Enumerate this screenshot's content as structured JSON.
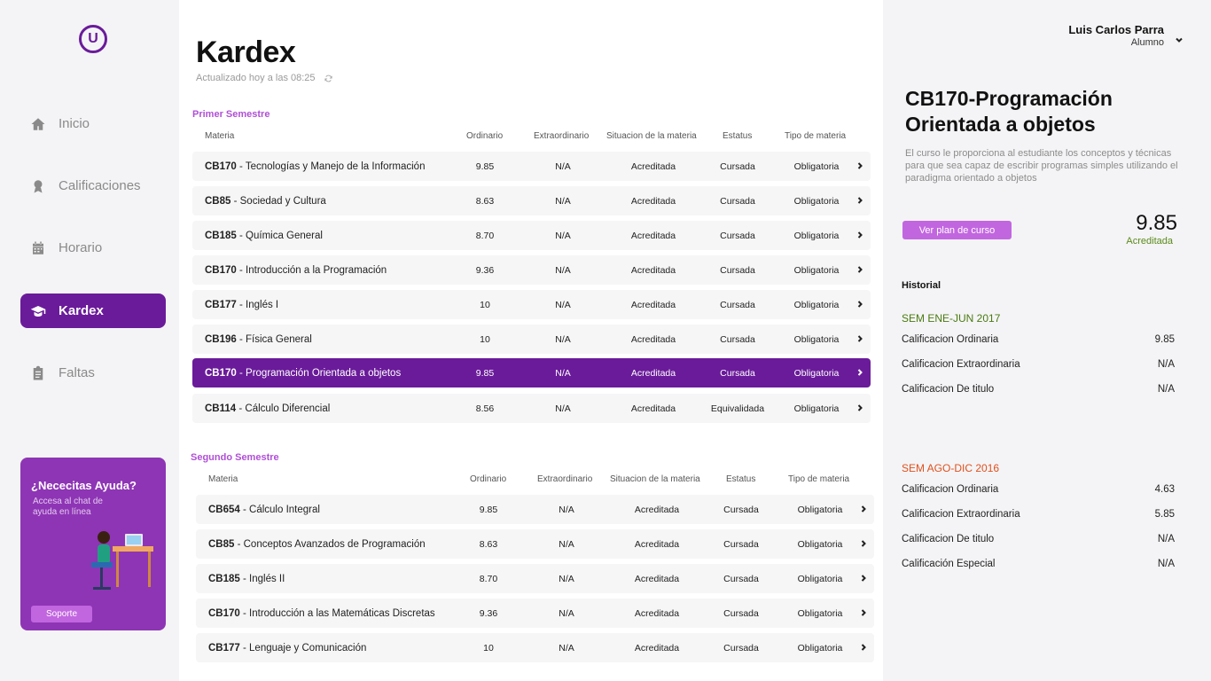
{
  "sidebar": {
    "logo_text": "U",
    "items": [
      {
        "label": "Inicio",
        "icon": "home-icon"
      },
      {
        "label": "Calificaciones",
        "icon": "award-icon"
      },
      {
        "label": "Horario",
        "icon": "calendar-icon"
      },
      {
        "label": "Kardex",
        "icon": "graduation-cap-icon"
      },
      {
        "label": "Faltas",
        "icon": "clipboard-icon"
      }
    ],
    "help": {
      "title": "¿Nececitas Ayuda?",
      "subtitle": "Accesa al chat de ayuda en línea",
      "button": "Soporte"
    }
  },
  "main": {
    "title": "Kardex",
    "updated": "Actualizado hoy a las 08:25",
    "columns": {
      "materia": "Materia",
      "ordinario": "Ordinario",
      "extraordinario": "Extraordinario",
      "situacion": "Situacion de la materia",
      "estatus": "Estatus",
      "tipo": "Tipo de materia"
    },
    "semesters": [
      {
        "title": "Primer Semestre",
        "rows": [
          {
            "code": "CB170",
            "name": " - Tecnologías y Manejo de la Información",
            "ordinario": "9.85",
            "extra": "N/A",
            "situacion": "Acreditada",
            "estatus": "Cursada",
            "tipo": "Obligatoria"
          },
          {
            "code": "CB85",
            "name": " - Sociedad y Cultura",
            "ordinario": "8.63",
            "extra": "N/A",
            "situacion": "Acreditada",
            "estatus": "Cursada",
            "tipo": "Obligatoria"
          },
          {
            "code": "CB185",
            "name": " - Química General",
            "ordinario": "8.70",
            "extra": "N/A",
            "situacion": "Acreditada",
            "estatus": "Cursada",
            "tipo": "Obligatoria"
          },
          {
            "code": "CB170",
            "name": " - Introducción a la Programación",
            "ordinario": "9.36",
            "extra": "N/A",
            "situacion": "Acreditada",
            "estatus": "Cursada",
            "tipo": "Obligatoria"
          },
          {
            "code": "CB177",
            "name": " - Inglés I",
            "ordinario": "10",
            "extra": "N/A",
            "situacion": "Acreditada",
            "estatus": "Cursada",
            "tipo": "Obligatoria"
          },
          {
            "code": "CB196",
            "name": " - Física General",
            "ordinario": "10",
            "extra": "N/A",
            "situacion": "Acreditada",
            "estatus": "Cursada",
            "tipo": "Obligatoria"
          },
          {
            "code": "CB170",
            "name": " - Programación Orientada a objetos",
            "ordinario": "9.85",
            "extra": "N/A",
            "situacion": "Acreditada",
            "estatus": "Cursada",
            "tipo": "Obligatoria"
          },
          {
            "code": "CB114",
            "name": " - Cálculo Diferencial",
            "ordinario": "8.56",
            "extra": "N/A",
            "situacion": "Acreditada",
            "estatus": "Equivalidada",
            "tipo": "Obligatoria"
          }
        ]
      },
      {
        "title": "Segundo Semestre",
        "rows": [
          {
            "code": "CB654",
            "name": " - Cálculo Integral",
            "ordinario": "9.85",
            "extra": "N/A",
            "situacion": "Acreditada",
            "estatus": "Cursada",
            "tipo": "Obligatoria"
          },
          {
            "code": "CB85",
            "name": " - Conceptos Avanzados de Programación",
            "ordinario": "8.63",
            "extra": "N/A",
            "situacion": "Acreditada",
            "estatus": "Cursada",
            "tipo": "Obligatoria"
          },
          {
            "code": "CB185",
            "name": " - Inglés II",
            "ordinario": "8.70",
            "extra": "N/A",
            "situacion": "Acreditada",
            "estatus": "Cursada",
            "tipo": "Obligatoria"
          },
          {
            "code": "CB170",
            "name": " - Introducción a las Matemáticas Discretas",
            "ordinario": "9.36",
            "extra": "N/A",
            "situacion": "Acreditada",
            "estatus": "Cursada",
            "tipo": "Obligatoria"
          },
          {
            "code": "CB177",
            "name": " - Lenguaje y Comunicación",
            "ordinario": "10",
            "extra": "N/A",
            "situacion": "Acreditada",
            "estatus": "Cursada",
            "tipo": "Obligatoria"
          }
        ]
      }
    ]
  },
  "user": {
    "name": "Luis Carlos Parra",
    "role": "Alumno"
  },
  "detail": {
    "title": "CB170-Programación Orientada a objetos",
    "description": "El curso le proporciona al estudiante los conceptos y técnicas para que sea capaz de escribir programas simples utilizando el paradigma orientado a objetos",
    "plan_button": "Ver plan de curso",
    "grade": "9.85",
    "grade_status": "Acreditada",
    "history_title": "Historial",
    "history": [
      {
        "semester": "SEM ENE-JUN 2017",
        "color": "#4a7a10",
        "items": [
          {
            "label": "Calificacion Ordinaria",
            "value": "9.85"
          },
          {
            "label": "Calificacion Extraordinaria",
            "value": "N/A"
          },
          {
            "label": "Calificacion De titulo",
            "value": "N/A"
          }
        ]
      },
      {
        "semester": "SEM AGO-DIC 2016",
        "color": "#e0501c",
        "items": [
          {
            "label": "Calificacion Ordinaria",
            "value": "4.63"
          },
          {
            "label": "Calificacion Extraordinaria",
            "value": "5.85"
          },
          {
            "label": "Calificacion De titulo",
            "value": "N/A"
          },
          {
            "label": "Calificación Especial",
            "value": "N/A"
          }
        ]
      }
    ]
  },
  "colors": {
    "accent": "#6a1b9a",
    "accent_light": "#c266e0",
    "semester_title": "#b04fd6"
  }
}
